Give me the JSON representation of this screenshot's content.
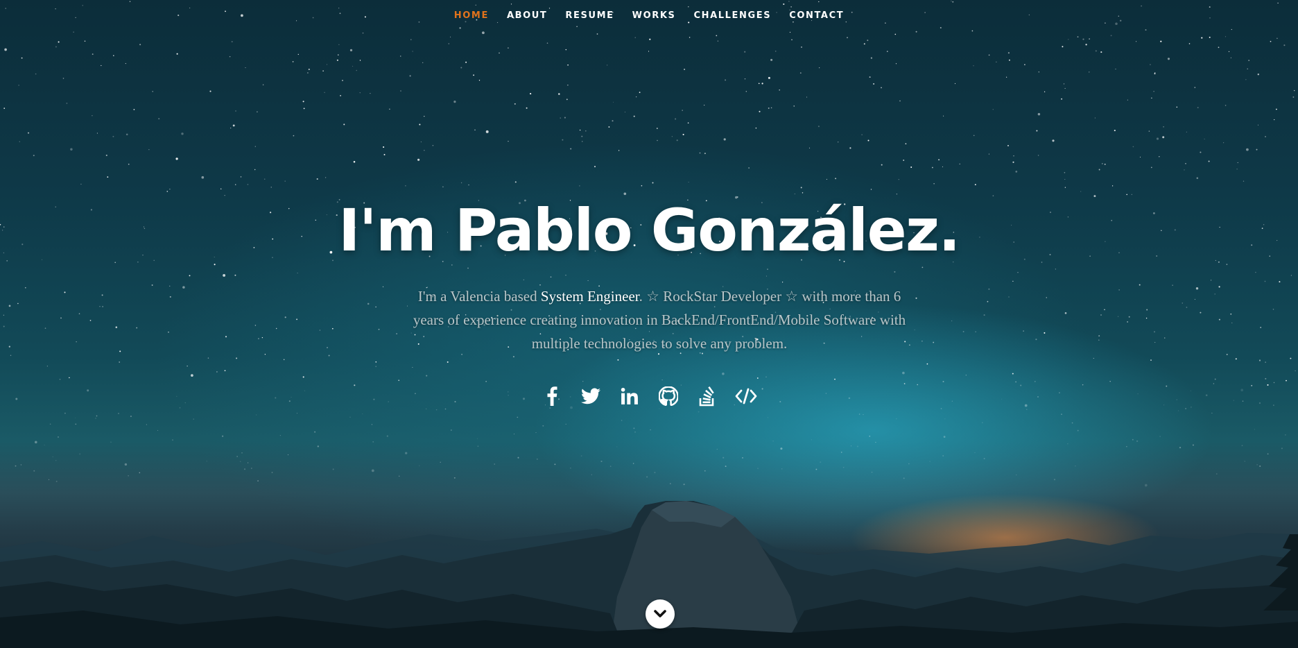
{
  "nav": {
    "items": [
      {
        "label": "HOME",
        "active": true
      },
      {
        "label": "ABOUT",
        "active": false
      },
      {
        "label": "RESUME",
        "active": false
      },
      {
        "label": "WORKS",
        "active": false
      },
      {
        "label": "CHALLENGES",
        "active": false
      },
      {
        "label": "CONTACT",
        "active": false
      }
    ],
    "active_color": "#e0731c",
    "text_color": "#ffffff"
  },
  "hero": {
    "title": "I'm Pablo González.",
    "intro_before": "I'm a Valencia based ",
    "intro_highlight": "System Engineer",
    "intro_after": ". ☆ RockStar Developer ☆ with more than 6 years of experience creating innovation in BackEnd/FrontEnd/Mobile Software with multiple technologies to solve any problem."
  },
  "social": [
    {
      "icon": "facebook-icon"
    },
    {
      "icon": "twitter-icon"
    },
    {
      "icon": "linkedin-icon"
    },
    {
      "icon": "github-icon"
    },
    {
      "icon": "stackoverflow-icon"
    },
    {
      "icon": "code-icon"
    }
  ],
  "scroll_button": {
    "icon": "chevron-down-icon"
  },
  "colors": {
    "sky_top": "#0c2d3a",
    "sky_glow": "#2db9d7",
    "horizon_glow": "#ff9646",
    "intro_text": "#b9c6c9"
  }
}
